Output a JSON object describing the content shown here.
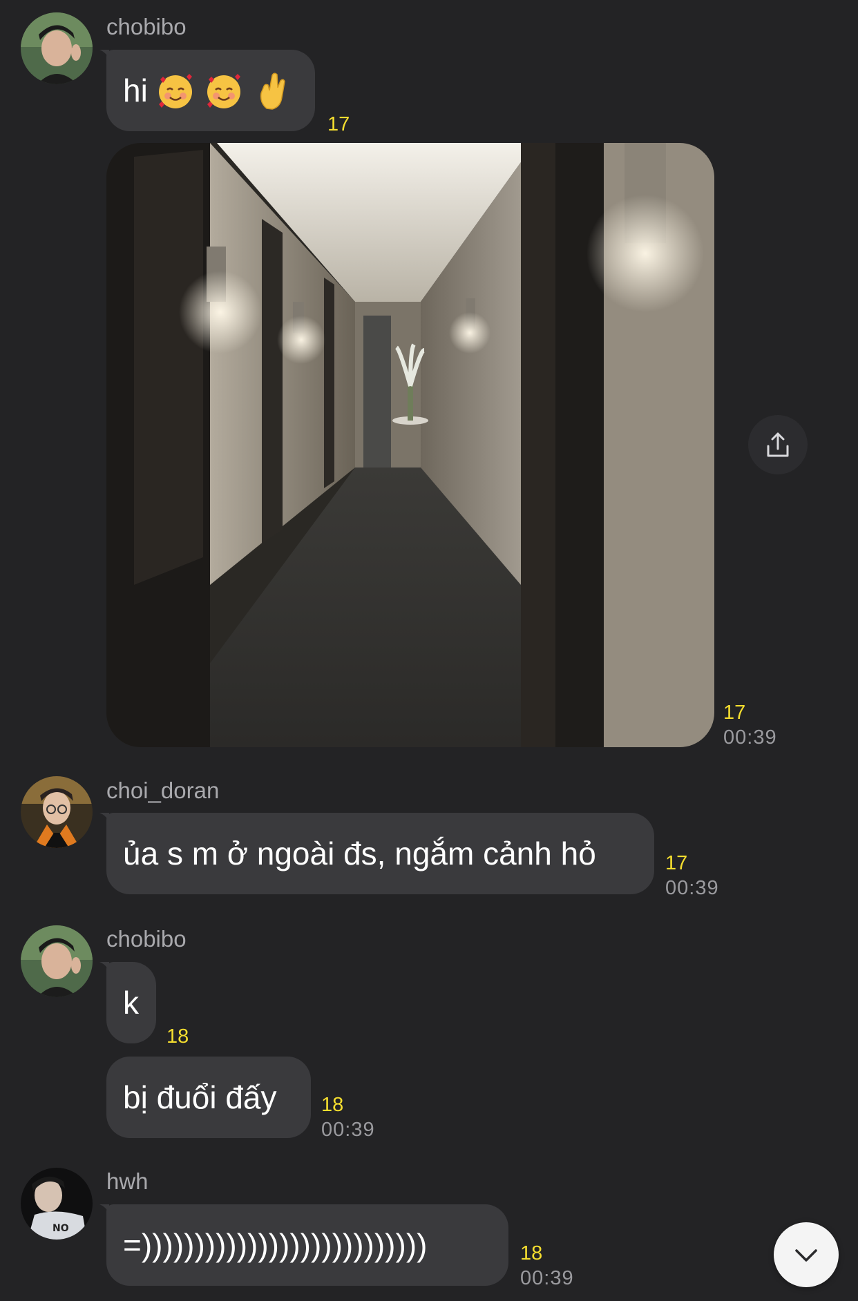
{
  "messages": [
    {
      "sender": "chobibo",
      "bubbles": [
        {
          "text": "hi",
          "emoji": [
            "smiling-face-with-hearts",
            "smiling-face-with-hearts",
            "crossed-fingers-hand"
          ],
          "read_count": "17"
        }
      ],
      "photo": {
        "subject": "hotel-hallway",
        "read_count": "17",
        "time": "00:39"
      }
    },
    {
      "sender": "choi_doran",
      "bubbles": [
        {
          "text": "ủa s m ở ngoài đs, ngắm cảnh hỏ",
          "read_count": "17",
          "time": "00:39"
        }
      ]
    },
    {
      "sender": "chobibo",
      "bubbles": [
        {
          "text": "k",
          "read_count": "18"
        },
        {
          "text": "bị đuổi đấy",
          "read_count": "18",
          "time": "00:39"
        }
      ]
    },
    {
      "sender": "hwh",
      "bubbles": [
        {
          "text": "=)))))))))))))))))))))))))))",
          "read_count": "18",
          "time": "00:39"
        }
      ]
    }
  ],
  "icons": {
    "share": "share-icon",
    "scroll_down": "chevron-down-icon"
  },
  "colors": {
    "background": "#232325",
    "bubble": "#3a3a3d",
    "read_count": "#f5de2f",
    "timestamp": "#9a9a9e",
    "username": "#a9a9ad"
  }
}
